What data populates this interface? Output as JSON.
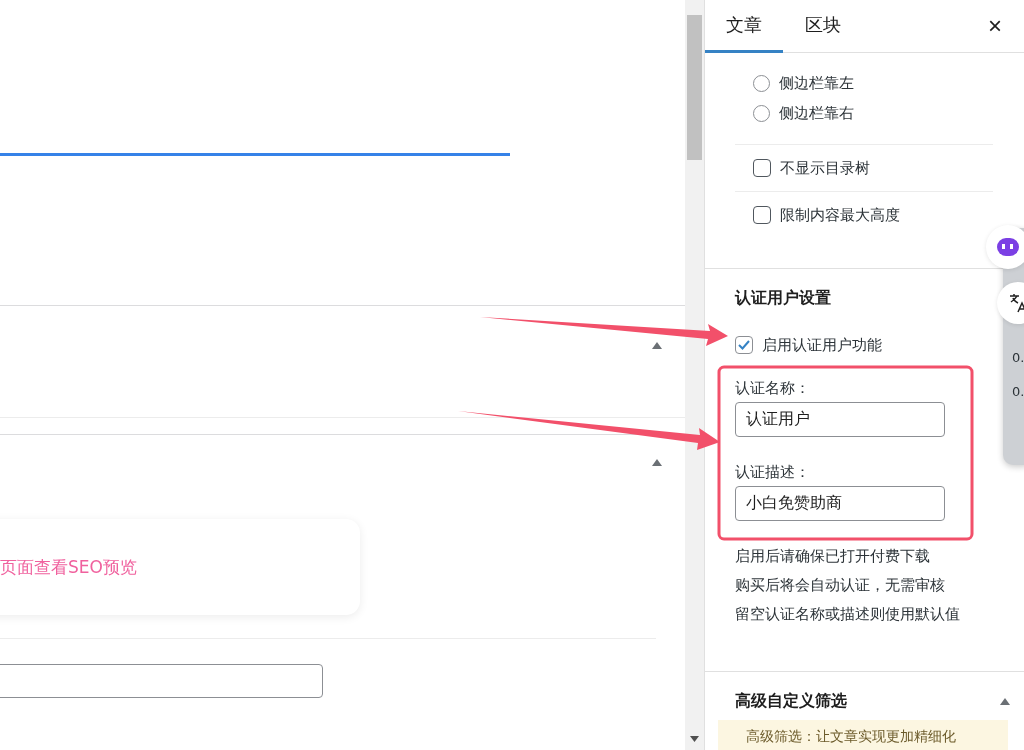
{
  "editor": {
    "panels": [
      {
        "expanded": true
      },
      {
        "expanded": true
      }
    ],
    "seo_hint": "页面查看SEO预览"
  },
  "sidebar": {
    "tabs": [
      {
        "label": "文章",
        "selected": true
      },
      {
        "label": "区块",
        "selected": false
      }
    ],
    "close": "×",
    "layout_options": [
      {
        "label": "侧边栏靠左",
        "selected": false
      },
      {
        "label": "侧边栏靠右",
        "selected": false
      }
    ],
    "toggles": [
      {
        "label": "不显示目录树",
        "checked": false
      },
      {
        "label": "限制内容最大高度",
        "checked": false
      }
    ],
    "verified_user": {
      "title": "认证用户设置",
      "enable": {
        "label": "启用认证用户功能",
        "checked": true
      },
      "fields": [
        {
          "label": "认证名称：",
          "value": "认证用户"
        },
        {
          "label": "认证描述：",
          "value": "小白免赞助商"
        }
      ],
      "notes": [
        "启用后请确保已打开付费下载",
        "购买后将会自动认证，无需审核",
        "留空认证名称或描述则使用默认值"
      ]
    },
    "advanced_filter": {
      "title": "高级自定义筛选",
      "expanded": true,
      "notice": "高级筛选：让文章实现更加精细化"
    }
  },
  "widget": {
    "readings": [
      "0.",
      "0."
    ]
  }
}
